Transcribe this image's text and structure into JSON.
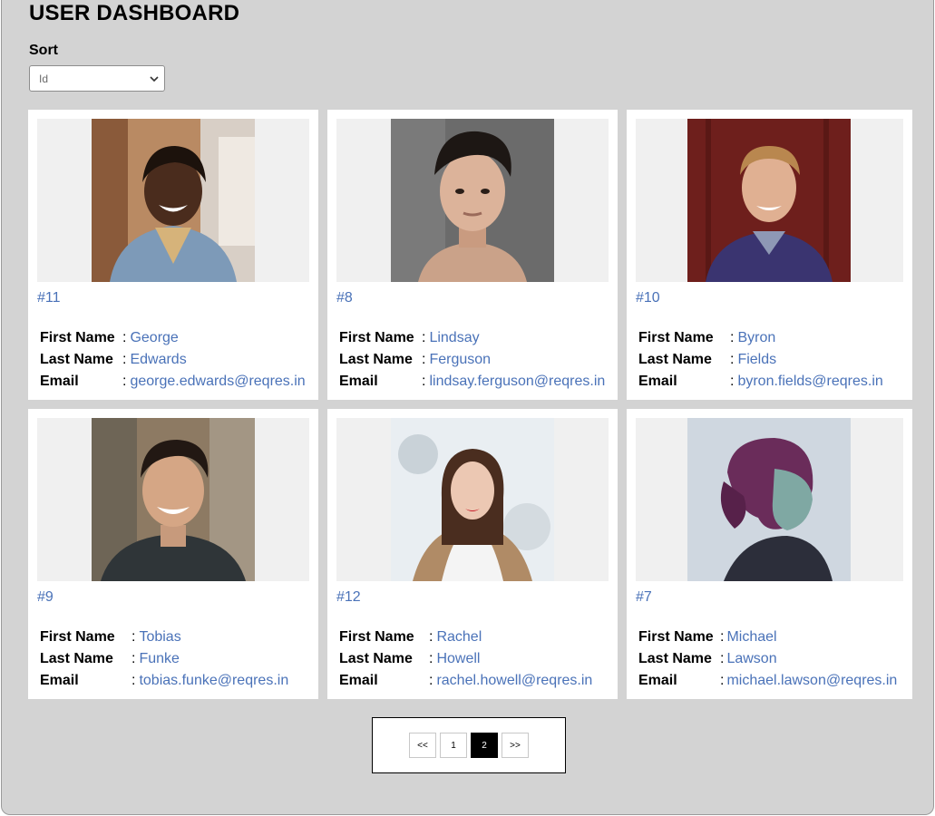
{
  "header": {
    "title": "USER DASHBOARD"
  },
  "sort": {
    "label": "Sort",
    "selected": "Id"
  },
  "users": [
    {
      "id": "#11",
      "first_name": "George",
      "last_name": "Edwards",
      "email": "george.edwards@reqres.in"
    },
    {
      "id": "#8",
      "first_name": "Lindsay",
      "last_name": "Ferguson",
      "email": "lindsay.ferguson@reqres.in"
    },
    {
      "id": "#10",
      "first_name": "Byron",
      "last_name": "Fields",
      "email": "byron.fields@reqres.in"
    },
    {
      "id": "#9",
      "first_name": "Tobias",
      "last_name": "Funke",
      "email": "tobias.funke@reqres.in"
    },
    {
      "id": "#12",
      "first_name": "Rachel",
      "last_name": "Howell",
      "email": "rachel.howell@reqres.in"
    },
    {
      "id": "#7",
      "first_name": "Michael",
      "last_name": "Lawson",
      "email": "michael.lawson@reqres.in"
    }
  ],
  "labels": {
    "first_name": "First Name",
    "last_name": "Last Name",
    "email": "Email",
    "separator": ":"
  },
  "pagination": {
    "prev": "<<",
    "pages": [
      "1",
      "2"
    ],
    "current": "2",
    "next": ">>"
  },
  "colors": {
    "page_bg": "#d3d3d3",
    "link_blue": "#4a72b8",
    "active_page": "#000000"
  }
}
